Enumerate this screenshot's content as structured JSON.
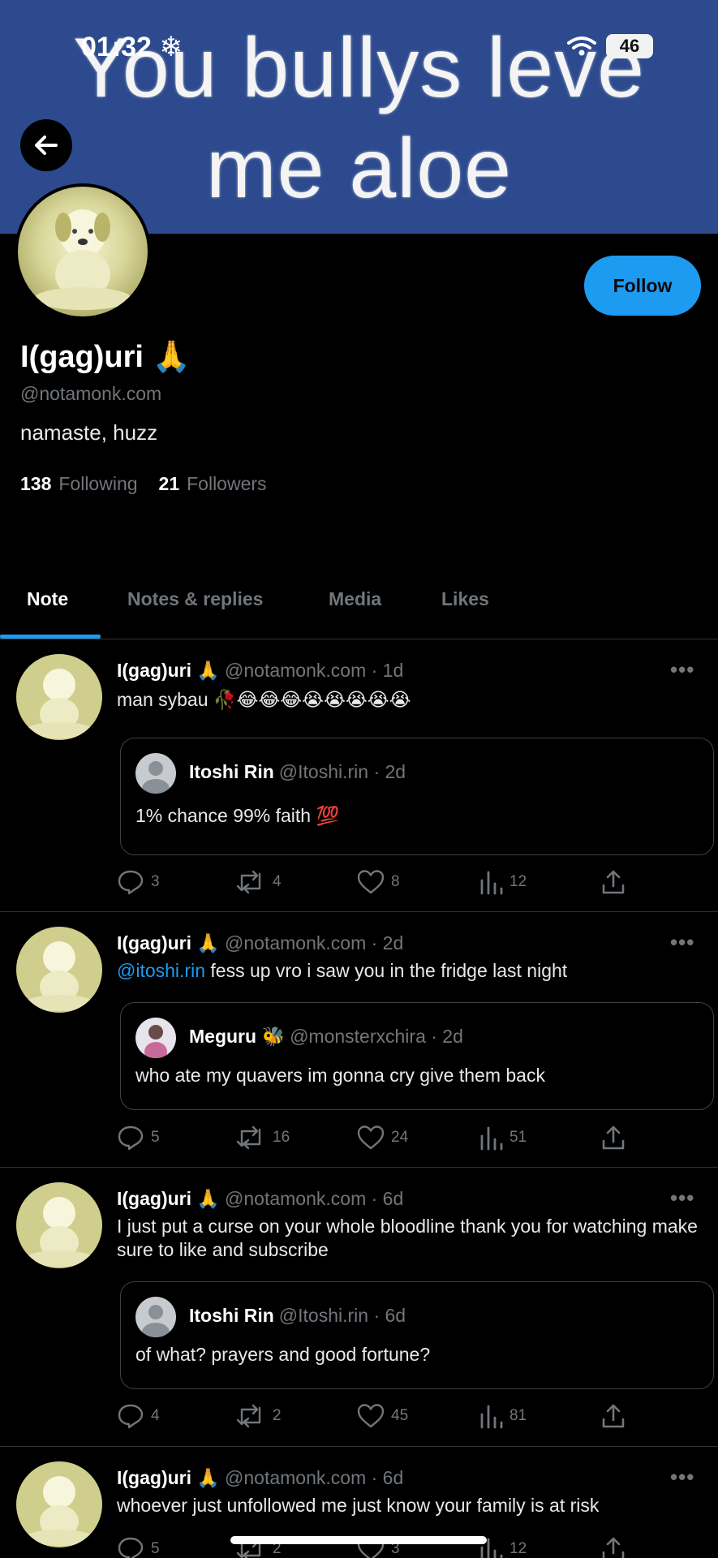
{
  "status_bar": {
    "time": "01:32",
    "battery": "46"
  },
  "banner": {
    "line1": "You bullys leve",
    "line2": "me aloe"
  },
  "profile": {
    "display_name": "I(gag)uri 🙏",
    "handle": "@notamonk.com",
    "bio": "namaste, huzz",
    "following_count": "138",
    "following_label": "Following",
    "followers_count": "21",
    "followers_label": "Followers",
    "follow_label": "Follow"
  },
  "tabs": [
    {
      "label": "Note"
    },
    {
      "label": "Notes & replies"
    },
    {
      "label": "Media"
    },
    {
      "label": "Likes"
    }
  ],
  "posts": [
    {
      "name": "I(gag)uri 🙏",
      "meta": "@notamonk.com · 1d",
      "text": "man sybau 🥀😂😂😂😭😭😭😭😭",
      "quote": {
        "name": "Itoshi Rin",
        "meta": "@Itoshi.rin · 2d",
        "text": "1% chance 99% faith 💯"
      },
      "replies": "3",
      "reposts": "4",
      "likes": "8",
      "views": "12"
    },
    {
      "name": "I(gag)uri 🙏",
      "meta": "@notamonk.com · 2d",
      "mention": "@itoshi.rin",
      "text": " fess up vro i saw you in the fridge last night",
      "quote": {
        "name": "Meguru 🐝",
        "meta": "@monsterxchira · 2d",
        "text": "who ate my quavers im gonna cry give them back"
      },
      "replies": "5",
      "reposts": "16",
      "likes": "24",
      "views": "51"
    },
    {
      "name": "I(gag)uri 🙏",
      "meta": "@notamonk.com · 6d",
      "text": "I just put a curse on your whole bloodline thank you for watching make sure to like and subscribe",
      "quote": {
        "name": "Itoshi Rin",
        "meta": "@Itoshi.rin · 6d",
        "text": "of what? prayers and good fortune?"
      },
      "replies": "4",
      "reposts": "2",
      "likes": "45",
      "views": "81"
    },
    {
      "name": "I(gag)uri 🙏",
      "meta": "@notamonk.com · 6d",
      "text": "whoever just unfollowed me just know your family is at risk",
      "replies": "5",
      "reposts": "2",
      "likes": "3",
      "views": "12"
    }
  ],
  "colors": {
    "accent": "#1d9bf0",
    "banner": "#2d4a8e",
    "muted": "#71767b",
    "background": "#000000"
  }
}
